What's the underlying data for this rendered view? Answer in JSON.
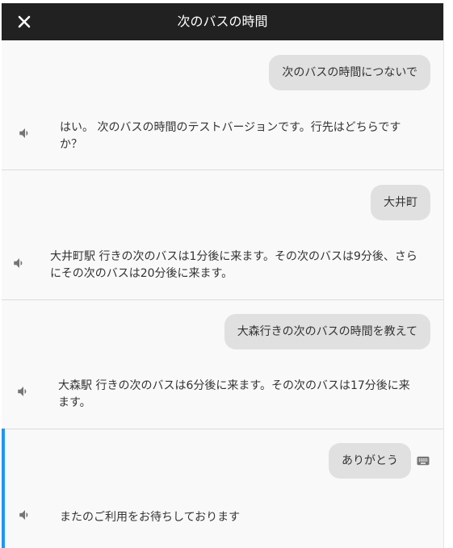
{
  "header": {
    "title": "次のバスの時間",
    "close_icon": "close-icon"
  },
  "colors": {
    "header_bg": "#212121",
    "panel_bg": "#f9f9f9",
    "bubble_bg": "#e0e0e0",
    "active_accent": "#2196f3"
  },
  "turns": [
    {
      "user": "次のバスの時間につないで",
      "reply_line1": "はい。 次のバスの時間のテストバージョンです。行先はどちらです",
      "reply_line2": "か？"
    },
    {
      "user": "大井町",
      "reply_line1": "大井町駅 行きの次のバスは1分後に来ます。その次のバスは9分後、さら",
      "reply_line2": "にその次のバスは20分後に来ます。"
    },
    {
      "user": "大森行きの次のバスの時間を教えて",
      "reply_line1": "大森駅 行きの次のバスは6分後に来ます。その次のバスは17分後に来",
      "reply_line2": "ます。"
    },
    {
      "user": "ありがとう",
      "reply_line1": "またのご利用をお待ちしております"
    }
  ],
  "icons": {
    "speaker": "speaker-icon",
    "keyboard": "keyboard-icon"
  }
}
